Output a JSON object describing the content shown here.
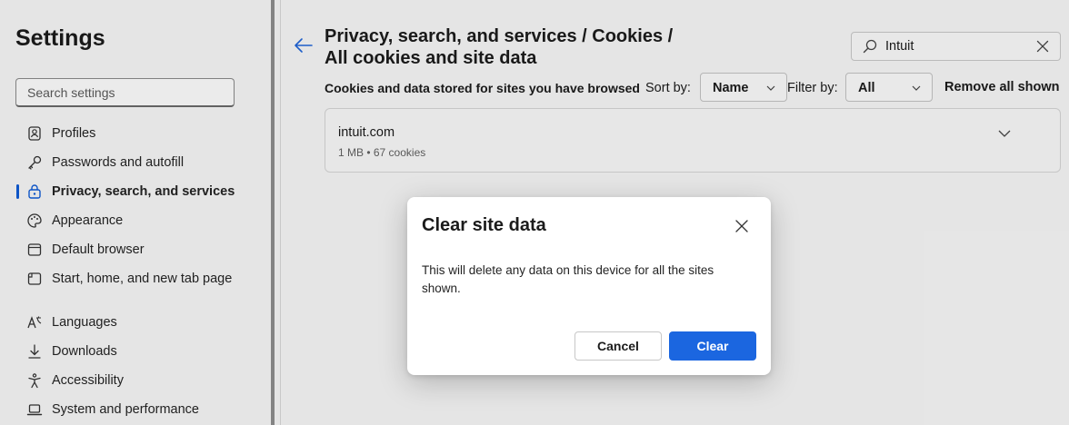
{
  "sidebar": {
    "title": "Settings",
    "search_placeholder": "Search settings",
    "items": [
      {
        "label": "Profiles",
        "icon": "profile-icon"
      },
      {
        "label": "Passwords and autofill",
        "icon": "key-icon"
      },
      {
        "label": "Privacy, search, and services",
        "icon": "lock-icon",
        "active": true
      },
      {
        "label": "Appearance",
        "icon": "palette-icon"
      },
      {
        "label": "Default browser",
        "icon": "browser-icon"
      },
      {
        "label": "Start, home, and new tab page",
        "icon": "home-tab-icon"
      },
      {
        "label": "Languages",
        "icon": "languages-icon"
      },
      {
        "label": "Downloads",
        "icon": "download-icon"
      },
      {
        "label": "Accessibility",
        "icon": "accessibility-icon"
      },
      {
        "label": "System and performance",
        "icon": "laptop-icon"
      }
    ]
  },
  "main": {
    "title_line1": "Privacy, search, and services / Cookies /",
    "title_line2": "All cookies and site data",
    "search_value": "Intuit",
    "description": "Cookies and data stored for sites you have browsed",
    "sort_label": "Sort by:",
    "sort_value": "Name",
    "filter_label": "Filter by:",
    "filter_value": "All",
    "remove_all_label": "Remove all shown",
    "sites": [
      {
        "name": "intuit.com",
        "meta": "1 MB • 67 cookies"
      }
    ]
  },
  "dialog": {
    "title": "Clear site data",
    "body": "This will delete any data on this device for all the sites shown.",
    "cancel_label": "Cancel",
    "clear_label": "Clear"
  },
  "colors": {
    "accent": "#1b66e0",
    "active_indicator": "#0f5bd6",
    "background": "#f7f7f7"
  }
}
